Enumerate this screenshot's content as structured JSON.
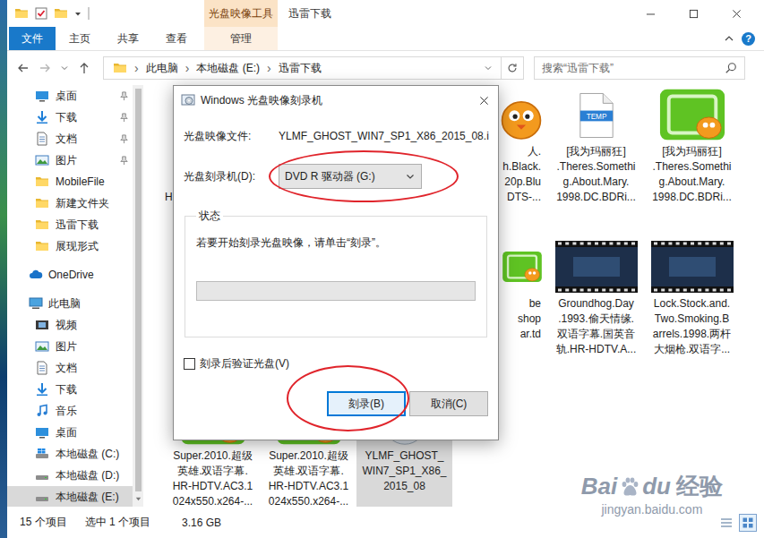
{
  "window": {
    "title": "迅雷下载",
    "context_tab": "光盘映像工具"
  },
  "ribbon": {
    "tabs": [
      {
        "label": "文件",
        "kind": "file",
        "selected": false
      },
      {
        "label": "主页",
        "kind": "plain",
        "selected": false
      },
      {
        "label": "共享",
        "kind": "plain",
        "selected": false
      },
      {
        "label": "查看",
        "kind": "plain",
        "selected": false
      },
      {
        "label": "管理",
        "kind": "context",
        "selected": false
      }
    ],
    "help": "?"
  },
  "address": {
    "path": [
      "此电脑",
      "本地磁盘 (E:)",
      "迅雷下载"
    ],
    "separator": "›"
  },
  "search": {
    "placeholder": "搜索“迅雷下载”"
  },
  "sidebar": {
    "items": [
      {
        "label": "桌面",
        "kind": "pinned",
        "selected": false
      },
      {
        "label": "下载",
        "kind": "pinned",
        "selected": false
      },
      {
        "label": "文档",
        "kind": "pinned",
        "selected": false
      },
      {
        "label": "图片",
        "kind": "pinned",
        "selected": false
      },
      {
        "label": "MobileFile",
        "kind": "plain",
        "selected": false
      },
      {
        "label": "新建文件夹",
        "kind": "plain",
        "selected": false
      },
      {
        "label": "迅雷下载",
        "kind": "plain",
        "selected": false
      },
      {
        "label": "展现形式",
        "kind": "plain",
        "selected": false
      },
      {
        "label": "OneDrive",
        "kind": "root",
        "selected": false
      },
      {
        "label": "此电脑",
        "kind": "root",
        "selected": false
      },
      {
        "label": "视频",
        "kind": "plain",
        "selected": false
      },
      {
        "label": "图片",
        "kind": "plain",
        "selected": false
      },
      {
        "label": "文档",
        "kind": "plain",
        "selected": false
      },
      {
        "label": "下载",
        "kind": "plain",
        "selected": false
      },
      {
        "label": "音乐",
        "kind": "plain",
        "selected": false
      },
      {
        "label": "桌面",
        "kind": "plain",
        "selected": false
      },
      {
        "label": "本地磁盘 (C:)",
        "kind": "plain",
        "selected": false
      },
      {
        "label": "本地磁盘 (D:)",
        "kind": "plain",
        "selected": false
      },
      {
        "label": "本地磁盘 (E:)",
        "kind": "plain",
        "selected": true
      }
    ]
  },
  "files": {
    "rows": [
      [
        {
          "kind": "xunlei",
          "partial": true,
          "selected": false,
          "lines": [
            "H"
          ]
        },
        {
          "kind": "covered",
          "partial": false,
          "selected": false,
          "lines": []
        },
        {
          "kind": "covered",
          "partial": false,
          "selected": false,
          "lines": []
        },
        {
          "kind": "xunlei",
          "partial": true,
          "selected": false,
          "lines": [
            "人.",
            "h.Black.",
            "20p.Blu",
            "DTS-..."
          ]
        },
        {
          "kind": "temp",
          "label": "TEMP",
          "partial": false,
          "selected": false,
          "lines": [
            "[我为玛丽狂]",
            ".Theres.Somethi",
            "g.About.Mary.",
            "1998.DC.BDRi..."
          ]
        },
        {
          "kind": "iqiyi",
          "partial": false,
          "selected": false,
          "lines": [
            "[我为玛丽狂]",
            ".Theres.Somethi",
            "g.About.Mary.",
            "1998.DC.BDRi..."
          ]
        }
      ],
      [
        {
          "kind": "covered",
          "partial": false,
          "selected": false,
          "lines": []
        },
        {
          "kind": "covered",
          "partial": false,
          "selected": false,
          "lines": []
        },
        {
          "kind": "covered",
          "partial": false,
          "selected": false,
          "lines": []
        },
        {
          "kind": "iqiyi",
          "partial": true,
          "selected": false,
          "lines": [
            "be",
            "shop",
            "ar.td"
          ]
        },
        {
          "kind": "thumb",
          "partial": false,
          "selected": false,
          "lines": [
            "Groundhog.Day",
            ".1993.偷天情缘.",
            "双语字幕.国英音",
            "轨.HR-HDTV.A..."
          ]
        },
        {
          "kind": "thumb",
          "partial": false,
          "selected": false,
          "lines": [
            "Lock.Stock.and.",
            "Two.Smoking.B",
            "arrels.1998.两杆",
            "大烟枪.双语字..."
          ]
        }
      ],
      [
        {
          "kind": "iqiyi",
          "partial": false,
          "selected": false,
          "lines": [
            "Super.2010.超级",
            "英雄.双语字幕.",
            "HR-HDTV.AC3.1",
            "024x550.x264-..."
          ]
        },
        {
          "kind": "iqiyi",
          "partial": false,
          "selected": false,
          "lines": [
            "Super.2010.超级",
            "英雄.双语字幕.",
            "HR-HDTV.AC3.1",
            "024x550.x264-..."
          ]
        },
        {
          "kind": "iso",
          "partial": false,
          "selected": true,
          "lines": [
            "YLMF_GHOST_",
            "WIN7_SP1_X86_",
            "2015_08"
          ]
        }
      ]
    ]
  },
  "status_bar": {
    "count": "15 个项目",
    "selection": "选中 1 个项目",
    "size": "3.16 GB",
    "views": [
      {
        "selected": false
      },
      {
        "selected": true
      }
    ]
  },
  "dialog": {
    "title": "Windows 光盘映像刻录机",
    "image_label": "光盘映像文件:",
    "image_file": "YLMF_GHOST_WIN7_SP1_X86_2015_08.i",
    "burner_label": "光盘刻录机(D):",
    "burner": "DVD R 驱动器 (G:)",
    "burner_highlighted": true,
    "status_title": "状态",
    "status_text": "若要开始刻录光盘映像，请单击“刻录”。",
    "progress": {
      "level": 0
    },
    "verify": {
      "label": "刻录后验证光盘(V)",
      "checked": false
    },
    "buttons": [
      {
        "label": "刻录(B)",
        "default": true,
        "highlighted": true
      },
      {
        "label": "取消(C)",
        "default": false,
        "highlighted": false
      }
    ]
  },
  "watermark": {
    "brand_left": "Bai",
    "brand_right": "du",
    "product": "经验",
    "url": "jingyan.baidu.com"
  }
}
